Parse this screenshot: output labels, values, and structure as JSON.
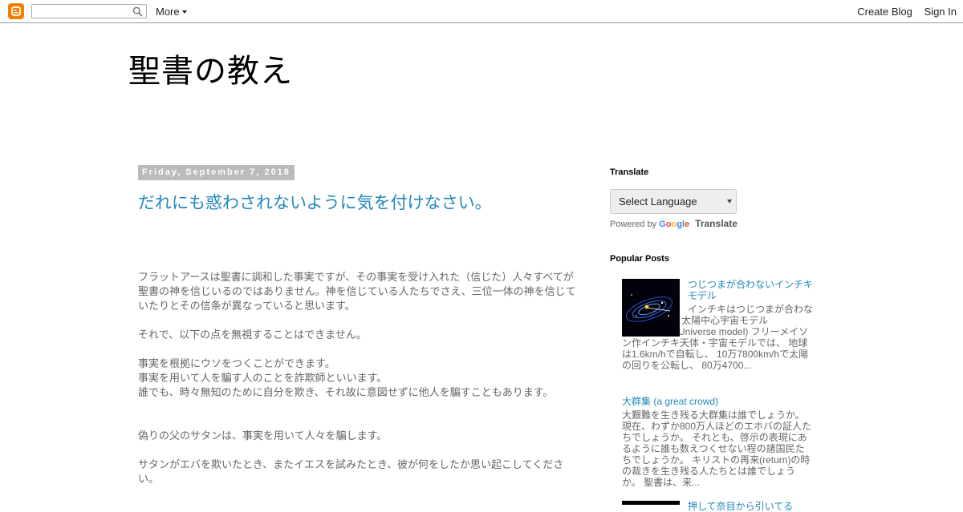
{
  "navbar": {
    "more_label": "More",
    "create_blog": "Create Blog",
    "sign_in": "Sign In"
  },
  "header": {
    "title": "聖書の教え"
  },
  "post": {
    "date": "Friday, September 7, 2018",
    "title": "だれにも惑わされないように気を付けなさい。",
    "paragraphs": [
      "フラットアースは聖書に調和した事実ですが、その事実を受け入れた（信じた）人々すべてが聖書の神を信じいるのではありません。神を信じている人たちでさえ、三位一体の神を信じていたりとその信条が異なっていると思います。",
      "それで、以下の点を無視することはできません。",
      "事実を根拠にウソをつくことができます。",
      "事実を用いて人を騙す人のことを詐欺師といいます。",
      "誰でも、時々無知のために自分を欺き、それ故に意図せずに他人を騙すこともあります。",
      "偽りの父のサタンは、事実を用いて人々を騙します。",
      "サタンがエバを欺いたとき、またイエスを試みたとき、彼が何をしたか思い起こしてください。"
    ]
  },
  "sidebar": {
    "translate_heading": "Translate",
    "select_language": "Select Language",
    "powered_by": "Powered by",
    "google": [
      "G",
      "o",
      "o",
      "g",
      "l",
      "e"
    ],
    "translate_link": "Translate",
    "popular_heading": "Popular Posts",
    "popular_posts": [
      {
        "title": "つじつまが合わないインチキモデル",
        "snippet": "インチキはつじつまが合わなくなります。 太陽中心宇宙モデル (Heliocentric Universe model) フリーメイソン作インチキ天体・宇宙モデルでは、 地球は1.6km/hで自転し、 10万7800km/hで太陽の回りを公転し、 80万4700..."
      },
      {
        "title": "大群集 (a great crowd)",
        "snippet": "大艱難を生き残る大群集は誰でしょうか。現在、わずか800万人ほどのエホバの証人たちでしょうか。 それとも、啓示の表現にあるように誰も数えつくせない程の諸国民たちでしょうか。 キリストの再来(return)の時の裁きを生き残る人たちとは誰でしょうか。 聖書は、来..."
      },
      {
        "title": "押して奈目から引いてる"
      }
    ]
  },
  "colors": {
    "link": "#2288bb",
    "text": "#666666",
    "date_bg": "#bbbbbb",
    "blogger_orange": "#f57d00"
  }
}
